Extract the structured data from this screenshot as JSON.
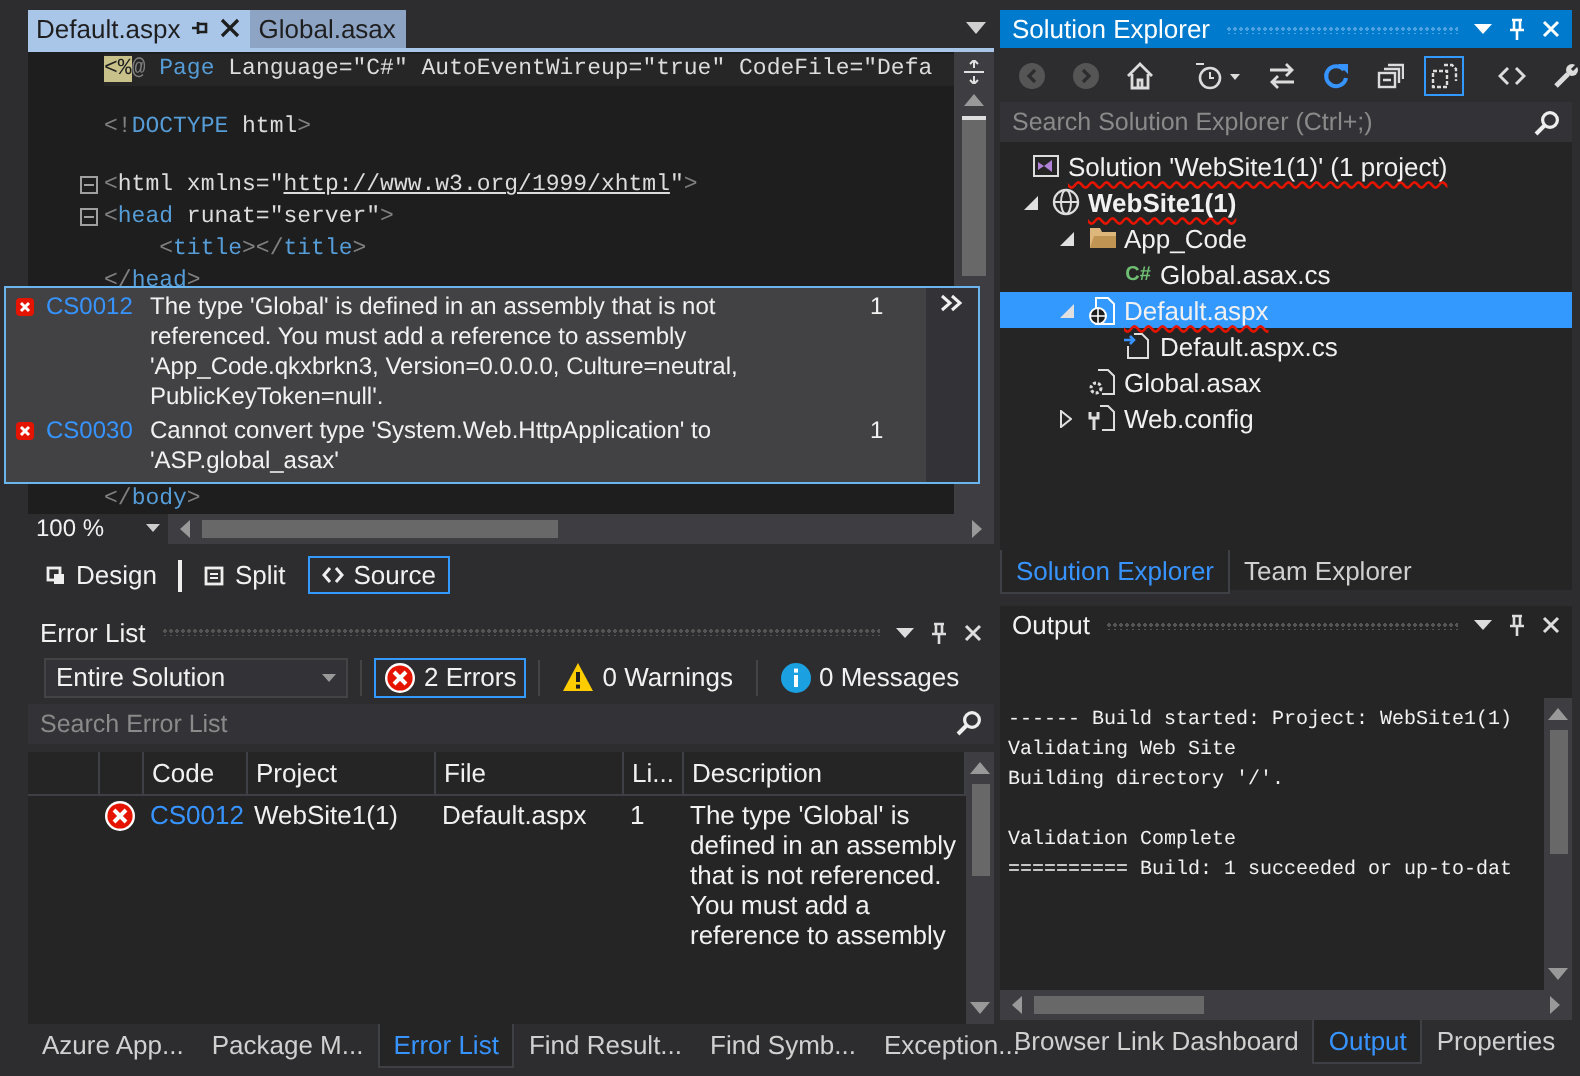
{
  "editor": {
    "tabs": [
      {
        "label": "Default.aspx",
        "selected": true,
        "pinned": true
      },
      {
        "label": "Global.asax",
        "selected": false,
        "pinned": false
      }
    ],
    "lines": [
      {
        "tokens": [
          {
            "kind": "marker",
            "text": "<%"
          },
          {
            "kind": "delim",
            "text": "@"
          },
          {
            "kind": "keyword",
            "text": " Page"
          },
          {
            "kind": "name",
            "text": " Language="
          },
          {
            "kind": "string",
            "text": "\"C#\""
          },
          {
            "kind": "name",
            "text": " AutoEventWireup="
          },
          {
            "kind": "string",
            "text": "\"true\""
          },
          {
            "kind": "name",
            "text": " CodeFile="
          },
          {
            "kind": "string",
            "text": "\"Defa"
          }
        ]
      },
      {
        "tokens": [
          {
            "kind": "delim",
            "text": "<!"
          },
          {
            "kind": "keyword",
            "text": "DOCTYPE"
          },
          {
            "kind": "name",
            "text": " html"
          },
          {
            "kind": "delim",
            "text": ">"
          }
        ]
      },
      {
        "expanded": true,
        "tokens": [
          {
            "kind": "delim",
            "text": "<"
          },
          {
            "kind": "name",
            "text": "html"
          },
          {
            "kind": "name",
            "text": " xmlns="
          },
          {
            "kind": "string",
            "text": "\""
          },
          {
            "kind": "link",
            "text": "http://www.w3.org/1999/xhtml"
          },
          {
            "kind": "string",
            "text": "\""
          },
          {
            "kind": "delim",
            "text": ">"
          }
        ]
      },
      {
        "expanded": true,
        "tokens": [
          {
            "kind": "delim",
            "text": "<"
          },
          {
            "kind": "keyword",
            "text": "head"
          },
          {
            "kind": "name",
            "text": " runat="
          },
          {
            "kind": "string",
            "text": "\"server\""
          },
          {
            "kind": "delim",
            "text": ">"
          }
        ]
      },
      {
        "tokens": [
          {
            "kind": "delim",
            "text": "    <"
          },
          {
            "kind": "keyword",
            "text": "title"
          },
          {
            "kind": "delim",
            "text": "></"
          },
          {
            "kind": "keyword",
            "text": "title"
          },
          {
            "kind": "delim",
            "text": ">"
          }
        ]
      },
      {
        "tokens": [
          {
            "kind": "delim",
            "text": "</"
          },
          {
            "kind": "keyword",
            "text": "head"
          },
          {
            "kind": "delim",
            "text": ">"
          }
        ]
      },
      {
        "tokens": [
          {
            "kind": "delim",
            "text": "</"
          },
          {
            "kind": "keyword",
            "text": "body"
          },
          {
            "kind": "delim",
            "text": ">"
          }
        ]
      }
    ],
    "zoom": "100 %",
    "view_buttons": [
      {
        "kind": "design",
        "label": "Design",
        "selected": false
      },
      {
        "kind": "split",
        "label": "Split",
        "selected": false
      },
      {
        "kind": "source",
        "label": "Source",
        "selected": true
      }
    ]
  },
  "tooltip": {
    "errors": [
      {
        "kind": "error",
        "code": "CS0012",
        "message": "The type 'Global' is defined in an assembly that is not referenced. You must add a reference to assembly 'App_Code.qkxbrkn3, Version=0.0.0.0, Culture=neutral, PublicKeyToken=null'.",
        "count": "1"
      },
      {
        "kind": "error",
        "code": "CS0030",
        "message": "Cannot convert type 'System.Web.HttpApplication' to 'ASP.global_asax'",
        "count": "1"
      }
    ]
  },
  "error_list": {
    "title": "Error List",
    "scope": "Entire Solution",
    "filters": [
      {
        "kind": "error",
        "label": "2 Errors",
        "selected": true
      },
      {
        "kind": "warning",
        "label": "0 Warnings",
        "selected": false
      },
      {
        "kind": "message",
        "label": "0 Messages",
        "selected": false
      }
    ],
    "search_placeholder": "Search Error List",
    "columns": [
      "Code",
      "Project",
      "File",
      "Li...",
      "Description"
    ],
    "rows": [
      {
        "kind": "error",
        "code": "CS0012",
        "project": "WebSite1(1)",
        "file": "Default.aspx",
        "line": "1",
        "description": "The type 'Global' is defined in an assembly that is not referenced. You must add a reference to assembly"
      }
    ]
  },
  "bottom_tabs_left": [
    {
      "label": "Azure App...",
      "selected": false
    },
    {
      "label": "Package M...",
      "selected": false
    },
    {
      "label": "Error List",
      "selected": true
    },
    {
      "label": "Find Result...",
      "selected": false
    },
    {
      "label": "Find Symb...",
      "selected": false
    },
    {
      "label": "Exception...",
      "selected": false
    }
  ],
  "solution_explorer": {
    "title": "Solution Explorer",
    "active": true,
    "toolbar": [
      {
        "kind": "back",
        "disabled": true,
        "selected": false
      },
      {
        "kind": "forward",
        "disabled": true,
        "selected": false
      },
      {
        "kind": "home",
        "disabled": false,
        "selected": false
      },
      {
        "kind": "history",
        "disabled": false,
        "selected": false
      },
      {
        "kind": "sync",
        "disabled": false,
        "selected": false
      },
      {
        "kind": "refresh",
        "disabled": false,
        "selected": false
      },
      {
        "kind": "collapse",
        "disabled": false,
        "selected": false
      },
      {
        "kind": "show-all",
        "disabled": false,
        "selected": true
      },
      {
        "kind": "code",
        "disabled": false,
        "selected": false
      },
      {
        "kind": "properties",
        "disabled": false,
        "selected": false
      }
    ],
    "search_placeholder": "Search Solution Explorer (Ctrl+;)",
    "tree": [
      {
        "label": "Solution 'WebSite1(1)' (1 project)",
        "kind": "solution",
        "squiggle": true,
        "selected": false,
        "children": [
          {
            "label": "WebSite1(1)",
            "kind": "globe",
            "squiggle": true,
            "startup": true,
            "expanded": true,
            "selected": false,
            "children": [
              {
                "label": "App_Code",
                "kind": "folder",
                "squiggle": false,
                "expanded": true,
                "selected": false,
                "children": [
                  {
                    "label": "Global.asax.cs",
                    "kind": "csharp",
                    "badge": "C#",
                    "squiggle": false,
                    "selected": false
                  }
                ]
              },
              {
                "label": "Default.aspx",
                "kind": "web-page",
                "squiggle": true,
                "expanded": true,
                "selected": true,
                "children": [
                  {
                    "label": "Default.aspx.cs",
                    "kind": "code-file",
                    "squiggle": false,
                    "selected": false
                  }
                ]
              },
              {
                "label": "Global.asax",
                "kind": "gear-file",
                "squiggle": false,
                "selected": false
              },
              {
                "label": "Web.config",
                "kind": "wrench-file",
                "squiggle": false,
                "expanded": false,
                "selected": false
              }
            ]
          }
        ]
      }
    ],
    "tabs": [
      {
        "label": "Solution Explorer",
        "selected": true
      },
      {
        "label": "Team Explorer",
        "selected": false
      }
    ]
  },
  "output": {
    "title": "Output",
    "paragraphs": [
      [
        "------ Build started: Project: WebSite1(1)",
        "Validating Web Site",
        "Building directory '/'."
      ],
      [
        "Validation Complete",
        "========== Build: 1 succeeded or up-to-dat"
      ]
    ]
  },
  "bottom_tabs_right": [
    {
      "label": "Browser Link Dashboard",
      "selected": false
    },
    {
      "label": "Output",
      "selected": true
    },
    {
      "label": "Properties",
      "selected": false
    }
  ]
}
